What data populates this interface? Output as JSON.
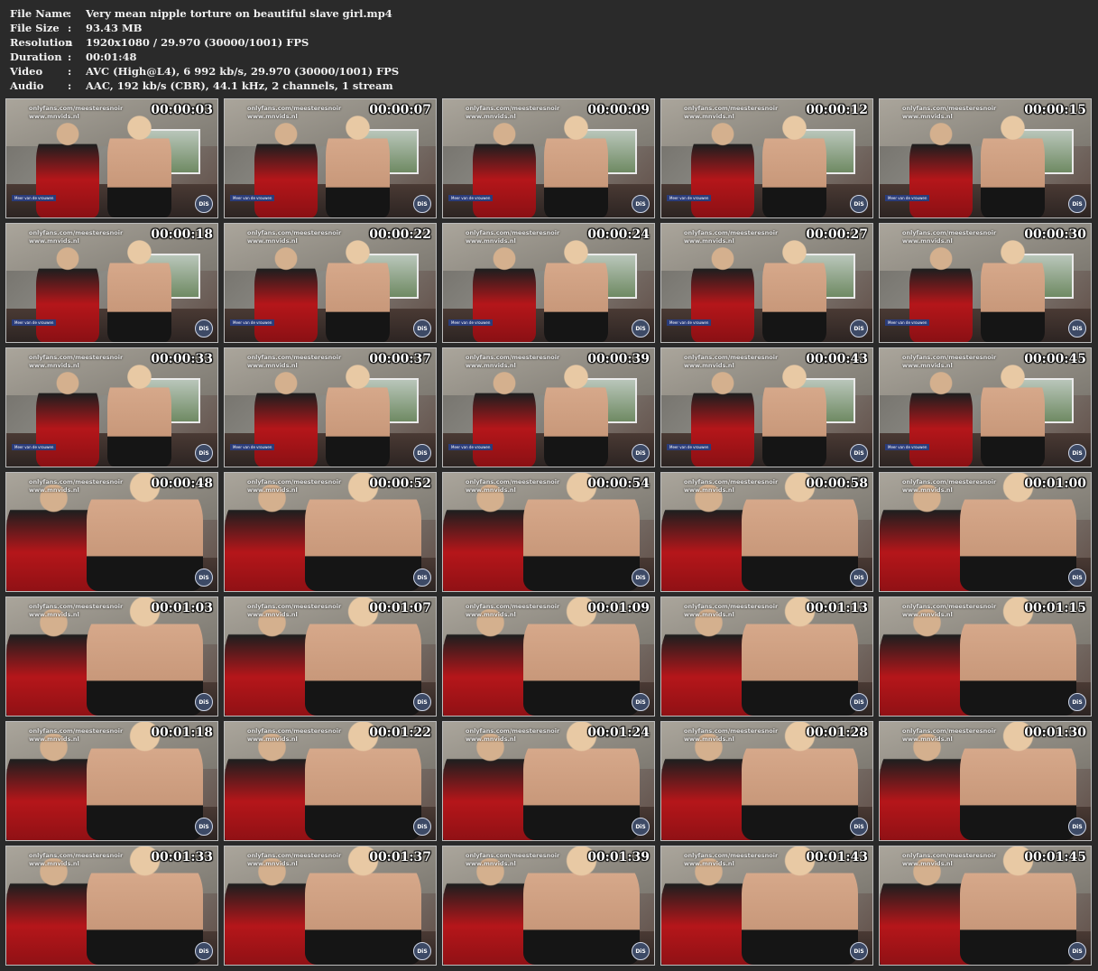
{
  "info": [
    {
      "key": "File Name",
      "sep": ":",
      "value": "Very mean nipple torture on beautiful slave girl.mp4"
    },
    {
      "key": "File Size",
      "sep": ":",
      "value": "93.43 MB"
    },
    {
      "key": "Resolution",
      "sep": ":",
      "value": "1920x1080 / 29.970 (30000/1001) FPS"
    },
    {
      "key": "Duration",
      "sep": ":",
      "value": "00:01:48"
    },
    {
      "key": "Video",
      "sep": ":",
      "value": "AVC (High@L4), 6 992 kb/s, 29.970 (30000/1001) FPS"
    },
    {
      "key": "Audio",
      "sep": ":",
      "value": "AAC, 192 kb/s (CBR), 44.1 kHz, 2 channels, 1 stream"
    }
  ],
  "watermark": {
    "line1": "onlyfans.com/meesteresnoir",
    "line2": "www.mnvids.nl"
  },
  "logo": "DiS",
  "sign": "Meer van de vrouwen",
  "thumbnails": [
    "00:00:03",
    "00:00:07",
    "00:00:09",
    "00:00:12",
    "00:00:15",
    "00:00:18",
    "00:00:22",
    "00:00:24",
    "00:00:27",
    "00:00:30",
    "00:00:33",
    "00:00:37",
    "00:00:39",
    "00:00:43",
    "00:00:45",
    "00:00:48",
    "00:00:52",
    "00:00:54",
    "00:00:58",
    "00:01:00",
    "00:01:03",
    "00:01:07",
    "00:01:09",
    "00:01:13",
    "00:01:15",
    "00:01:18",
    "00:01:22",
    "00:01:24",
    "00:01:28",
    "00:01:30",
    "00:01:33",
    "00:01:37",
    "00:01:39",
    "00:01:43",
    "00:01:45"
  ]
}
